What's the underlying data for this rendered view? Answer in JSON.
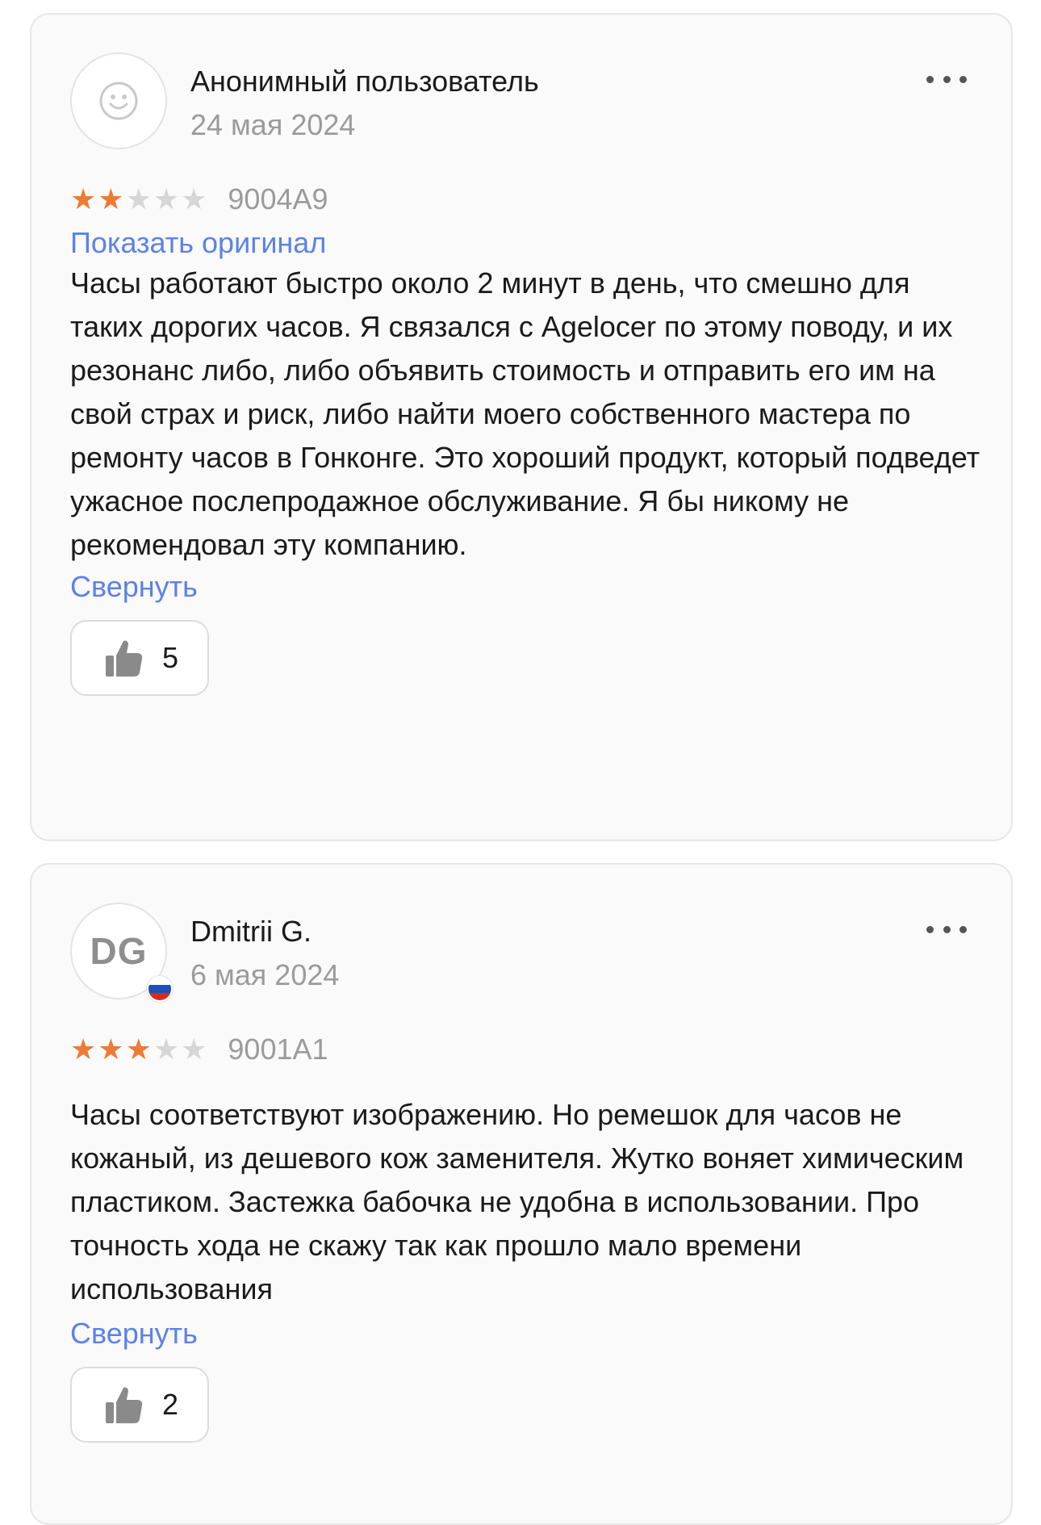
{
  "reviews": [
    {
      "author": "Анонимный пользователь",
      "date": "24 мая 2024",
      "rating": 2,
      "max_rating": 5,
      "sku": "9004A9",
      "show_original_label": "Показать оригинал",
      "text": "Часы работают быстро около 2 минут в день, что смешно для таких дорогих часов. Я связался с Agelocer по этому поводу, и их резонанс либо, либо объявить стоимость и отправить его им на свой страх и риск, либо найти моего собственного мастера по ремонту часов в Гонконге. Это хороший продукт, который подведет ужасное послепродажное обслуживание. Я бы никому не рекомендовал эту компанию.",
      "collapse_label": "Свернуть",
      "likes": "5",
      "avatar_icon": "smiley-icon"
    },
    {
      "author": "Dmitrii G.",
      "date": "6 мая 2024",
      "initials": "DG",
      "country_flag": "russia-flag-icon",
      "rating": 3,
      "max_rating": 5,
      "sku": "9001A1",
      "text": "Часы соответствуют изображению.  Но ремешок для часов не кожаный, из дешевого кож заменителя. Жутко воняет химическим пластиком. Застежка бабочка не удобна в использовании. Про точность хода не скажу так как прошло мало времени использования",
      "collapse_label": "Свернуть",
      "likes": "2"
    }
  ],
  "colors": {
    "star_on": "#ef7a33",
    "star_off": "#d6d6d6",
    "link": "#5b82e8",
    "muted": "#9b9b9b"
  }
}
